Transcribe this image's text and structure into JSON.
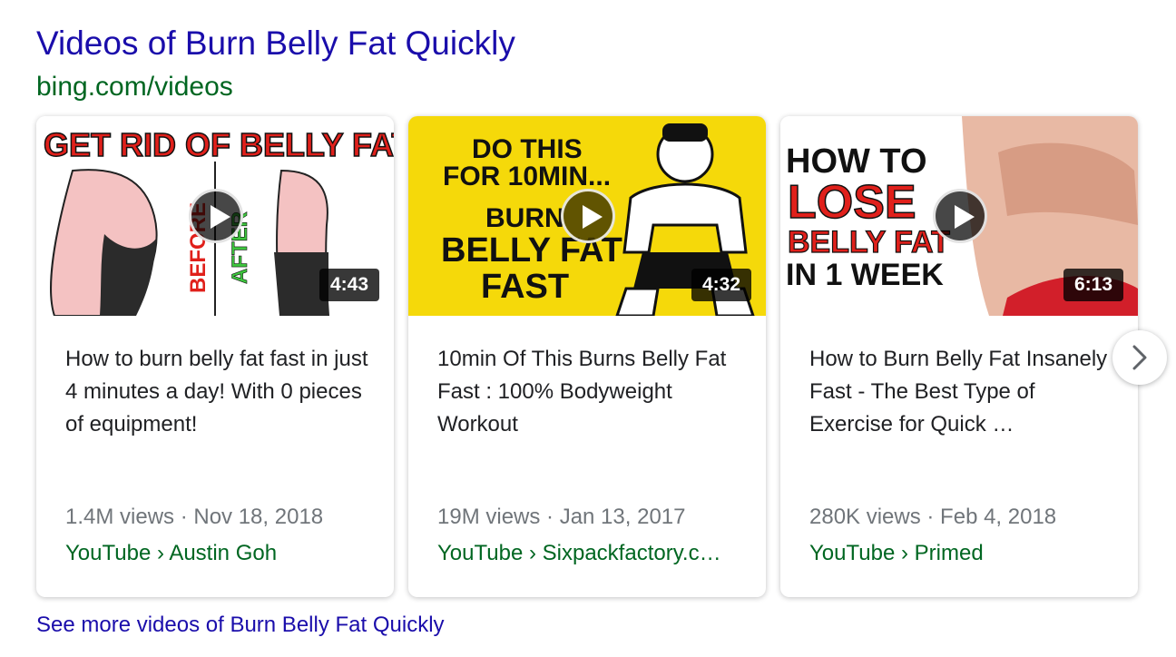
{
  "header": {
    "title": "Videos of Burn Belly Fat Quickly",
    "source": "bing.com/videos"
  },
  "videos": [
    {
      "thumb_text": [
        "GET RID OF BELLY FAT",
        "BEFORE",
        "AFTER"
      ],
      "duration": "4:43",
      "title": "How to burn belly fat fast in just 4 minutes a day! With 0 pieces of equipment!",
      "meta": "1.4M views · Nov 18, 2018",
      "channel": "YouTube › Austin Goh"
    },
    {
      "thumb_text": [
        "DO THIS",
        "FOR 10MIN...",
        "BURN",
        "BELLY FAT",
        "FAST"
      ],
      "duration": "4:32",
      "title": "10min Of This Burns Belly Fat Fast : 100% Bodyweight Workout",
      "meta": "19M views · Jan 13, 2017",
      "channel": "YouTube › Sixpackfactory.c…"
    },
    {
      "thumb_text": [
        "HOW TO",
        "LOSE",
        "BELLY FAT",
        "IN 1 WEEK"
      ],
      "duration": "6:13",
      "title": "How to Burn Belly Fat Insanely Fast - The Best Type of Exercise for Quick …",
      "meta": "280K views · Feb 4, 2018",
      "channel": "YouTube › Primed"
    }
  ],
  "footer": {
    "see_more": "See more videos of Burn Belly Fat Quickly"
  },
  "icons": {
    "play": "play-icon",
    "next": "chevron-right-icon"
  },
  "colors": {
    "link": "#1a0dab",
    "url_green": "#006621",
    "meta_gray": "#70757a",
    "thumb2_bg": "#f5d90a",
    "thumb_red": "#e0201b"
  }
}
